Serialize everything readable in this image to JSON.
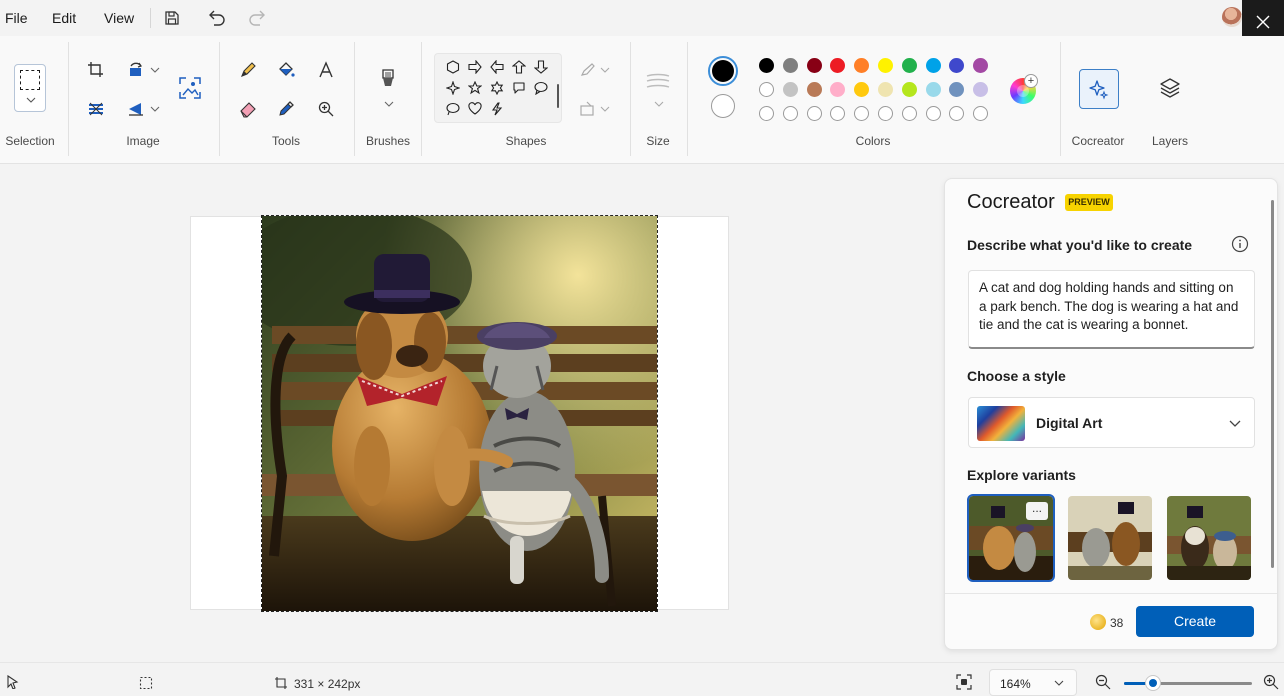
{
  "menu": {
    "file": "File",
    "edit": "Edit",
    "view": "View"
  },
  "ribbon": {
    "groups": {
      "selection": "Selection",
      "image": "Image",
      "tools": "Tools",
      "brushes": "Brushes",
      "shapes": "Shapes",
      "size": "Size",
      "colors": "Colors",
      "cocreator": "Cocreator",
      "layers": "Layers"
    },
    "palette_row1": [
      "#000000",
      "#7f7f7f",
      "#880015",
      "#ed1c24",
      "#ff7f27",
      "#fff200",
      "#22b14c",
      "#00a2e8",
      "#3f48cc",
      "#a349a4"
    ],
    "palette_row2": [
      "#ffffff",
      "#c3c3c3",
      "#b97a57",
      "#ffaec9",
      "#ffc90e",
      "#efe4b0",
      "#b5e61d",
      "#99d9ea",
      "#7092be",
      "#c8bfe7"
    ],
    "palette_row3_count": 10,
    "primary_color": "#000000",
    "secondary_color": "#ffffff"
  },
  "cocreator": {
    "title": "Cocreator",
    "badge": "PREVIEW",
    "describe_label": "Describe what you'd like to create",
    "prompt": "A cat and dog holding hands and sitting on a park bench. The dog is wearing a hat and tie and the cat is wearing a bonnet.",
    "style_label": "Choose a style",
    "style_value": "Digital Art",
    "variants_label": "Explore variants",
    "variant_more": "...",
    "credits": "38",
    "create_label": "Create",
    "accent": "#005fb8"
  },
  "status": {
    "canvas_size": "331 × 242px",
    "zoom": "164%",
    "zoom_level_fraction": 0.23
  }
}
